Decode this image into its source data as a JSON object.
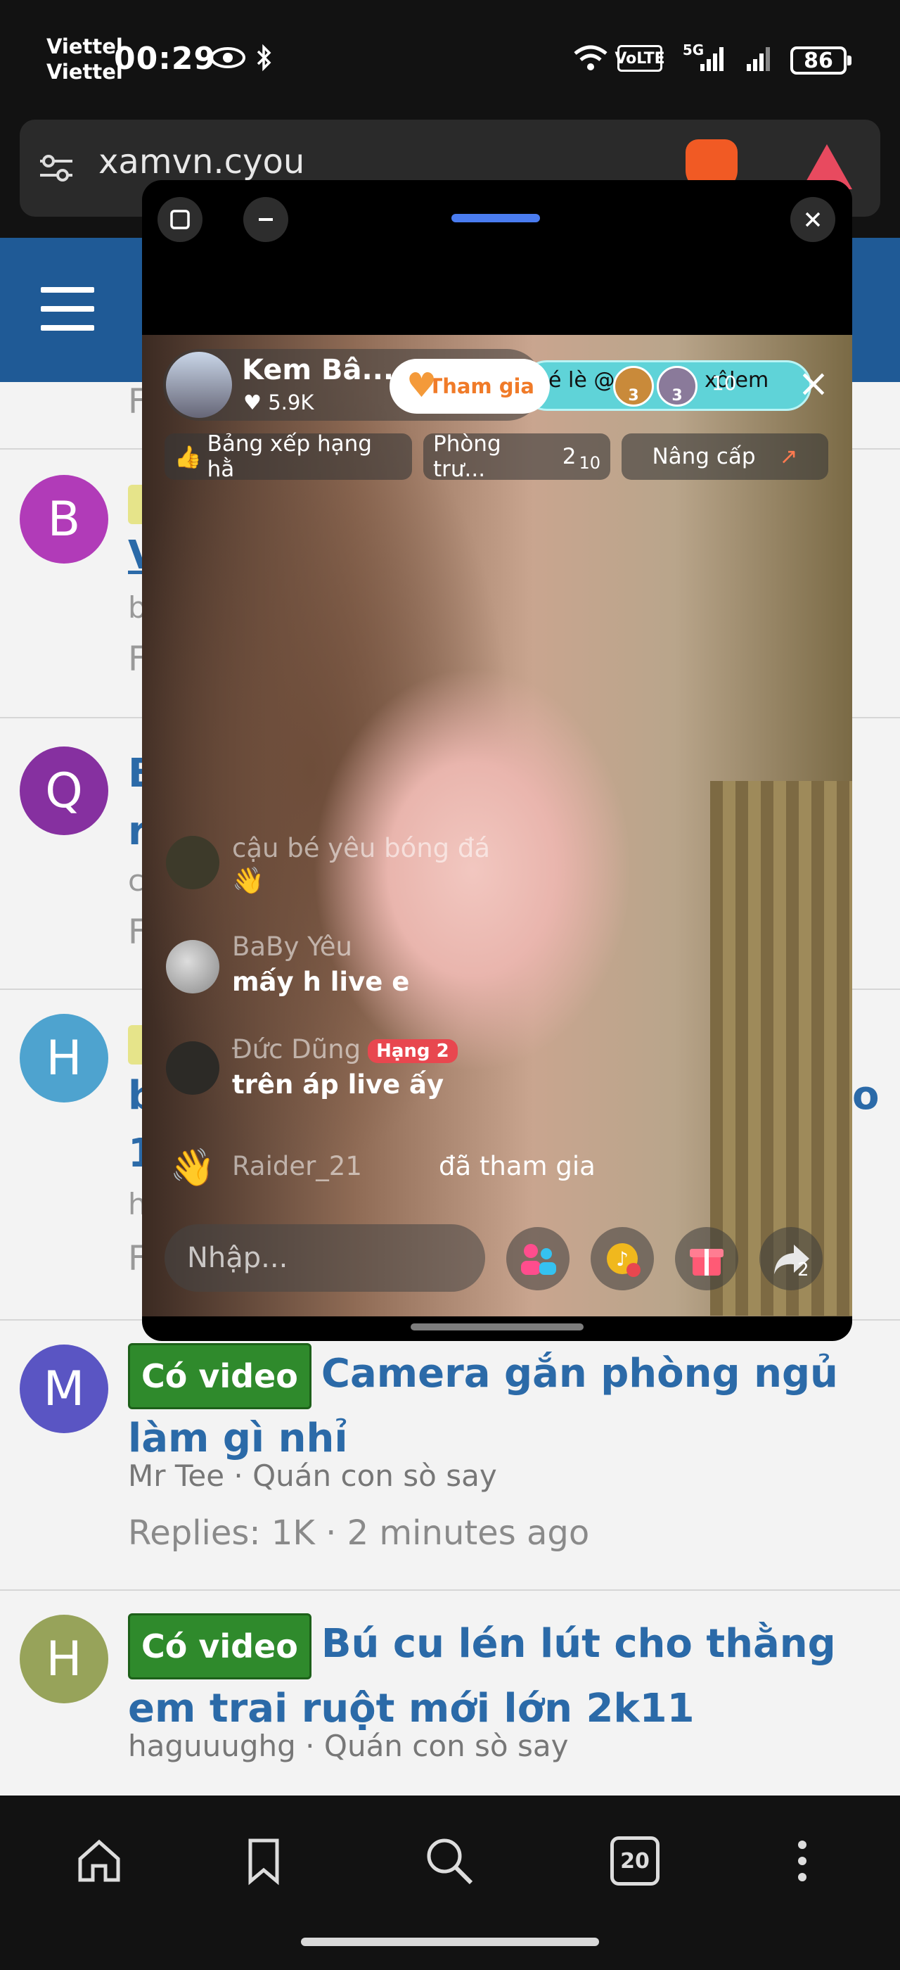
{
  "status_bar": {
    "carrier_1": "Viettel",
    "carrier_2": "Viettel",
    "time": "00:29",
    "battery": "86",
    "network": "VoLTE",
    "network_gen": "5G"
  },
  "browser": {
    "url": "xamvn.cyou"
  },
  "threads": [
    {
      "avatar_letter": "B",
      "avatar_color": "#b13bb8",
      "title_fragment": "V",
      "meta_fragment": "b",
      "replies_fragment": "F"
    },
    {
      "avatar_letter": "Q",
      "avatar_color": "#8630a0",
      "title_fragment": "B",
      "title_fragment_2": "r",
      "meta_fragment": "c",
      "replies_fragment": "F"
    },
    {
      "avatar_letter": "H",
      "avatar_color": "#4ea3cf",
      "title_fragment": "b",
      "title_fragment_2": "1",
      "title_end": "o",
      "meta_fragment": "h",
      "replies_fragment": "F"
    },
    {
      "avatar_letter": "M",
      "avatar_color": "#5a55c3",
      "tag": "Có video",
      "title": "Camera gắn phòng ngủ làm gì nhỉ",
      "author": "Mr Tee",
      "forum": "Quán con sò say",
      "replies": "Replies: 1K · 2 minutes ago"
    },
    {
      "avatar_letter": "H",
      "avatar_color": "#97a35a",
      "tag": "Có video",
      "title": "Bú cu lén lút cho thằng em trai ruột mới lớn 2k11",
      "author": "haguuughg",
      "forum": "Quán con sò say"
    }
  ],
  "live": {
    "host_name": "Kem Bâ...",
    "host_likes": "5.9K",
    "join_label": "Tham gia",
    "banner_text": "é lè @",
    "banner_tail": "xôlem",
    "banner_count": "10",
    "mini_badge_1": "3",
    "mini_badge_2": "3",
    "pills": [
      "Bảng xếp hạng hằ",
      "Phòng trư...",
      "Nâng cấp"
    ],
    "pill_room_num": "2",
    "pill_room_den": "10",
    "chat": [
      {
        "name": "cậu bé yêu bóng đá",
        "msg": "👋"
      },
      {
        "name": "BaBy Yêu",
        "msg": "mấy h live e"
      },
      {
        "name": "Đức Dũng",
        "badge": "Hạng 2",
        "msg": "trên áp live ấy"
      },
      {
        "name": "Raider_21",
        "msg": "đã tham gia"
      }
    ],
    "input_placeholder": "Nhập...",
    "share_count": "2"
  },
  "bottom_nav": {
    "tab_count": "20"
  }
}
